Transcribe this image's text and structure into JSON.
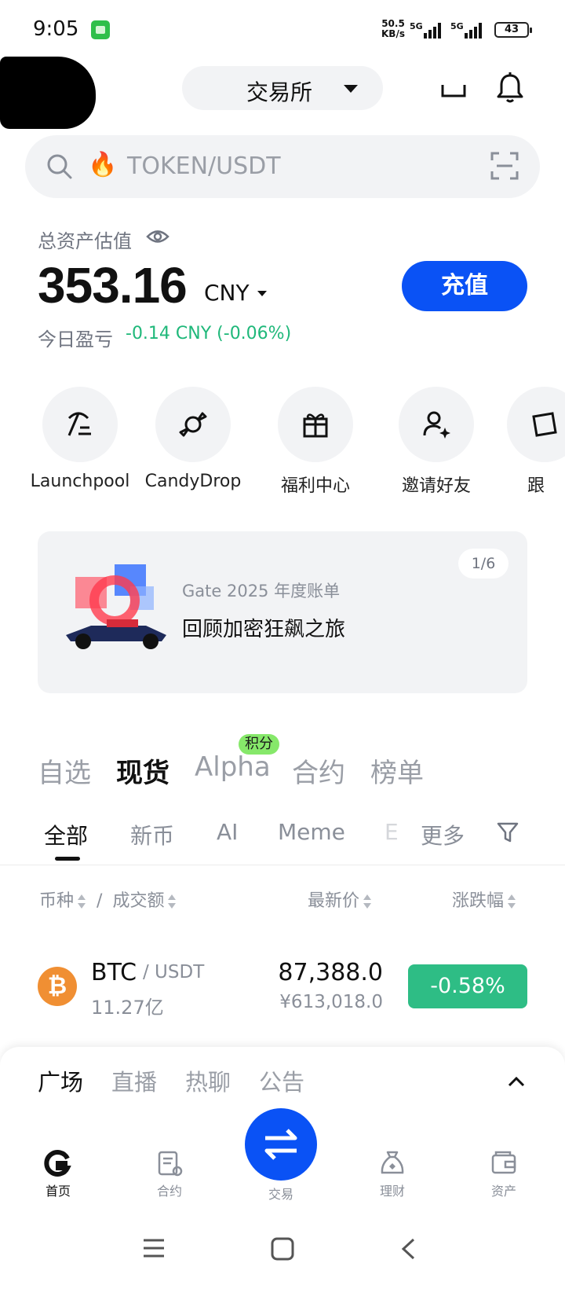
{
  "status_bar": {
    "time": "9:05",
    "net_speed_value": "50.5",
    "net_speed_unit": "KB/s",
    "sim1": "5G",
    "sim2": "5G",
    "battery": "43"
  },
  "header": {
    "exchange_label": "交易所"
  },
  "search": {
    "placeholder": "TOKEN/USDT"
  },
  "assets": {
    "label": "总资产估值",
    "value": "353.16",
    "currency": "CNY",
    "deposit_label": "充值",
    "pnl_label": "今日盈亏",
    "pnl_value": "-0.14 CNY (-0.06%)"
  },
  "quick_actions": [
    {
      "label": "Launchpool",
      "icon": "pickaxe-icon"
    },
    {
      "label": "CandyDrop",
      "icon": "candy-icon"
    },
    {
      "label": "福利中心",
      "icon": "gift-icon"
    },
    {
      "label": "邀请好友",
      "icon": "invite-user-icon"
    },
    {
      "label": "跟",
      "icon": "copy-trade-icon"
    }
  ],
  "banner": {
    "page_indicator": "1/6",
    "subtitle": "Gate 2025 年度账单",
    "title": "回顾加密狂飙之旅"
  },
  "market_tabs": {
    "items": [
      "自选",
      "现货",
      "Alpha",
      "合约",
      "榜单"
    ],
    "active": "现货",
    "alpha_badge": "积分"
  },
  "sub_tabs": {
    "items": [
      "全部",
      "新币",
      "AI",
      "Meme",
      "E",
      "更多"
    ],
    "active": "全部"
  },
  "table_header": {
    "coin": "币种",
    "separator": "/",
    "volume": "成交额",
    "price": "最新价",
    "change": "涨跌幅"
  },
  "rows": [
    {
      "symbol": "BTC",
      "quote": "/ USDT",
      "volume": "11.27亿",
      "price": "87,388.0",
      "price_cny": "¥613,018.0",
      "change": "-0.58%",
      "logo_glyph": "₿"
    }
  ],
  "sheet": {
    "tabs": [
      "广场",
      "直播",
      "热聊",
      "公告"
    ],
    "active": "广场"
  },
  "bottom_nav": [
    {
      "label": "首页",
      "icon": "home-icon",
      "active": true
    },
    {
      "label": "合约",
      "icon": "contract-icon",
      "active": false
    },
    {
      "label": "交易",
      "icon": "trade-swap-icon",
      "active": false
    },
    {
      "label": "理财",
      "icon": "finance-bag-icon",
      "active": false
    },
    {
      "label": "资产",
      "icon": "wallet-icon",
      "active": false
    }
  ],
  "colors": {
    "accent_blue": "#0a52f5",
    "up_green": "#2ebd85",
    "pnl_green": "#1fb87a",
    "alpha_badge_green": "#86e86a",
    "btc_orange": "#f08f33"
  }
}
